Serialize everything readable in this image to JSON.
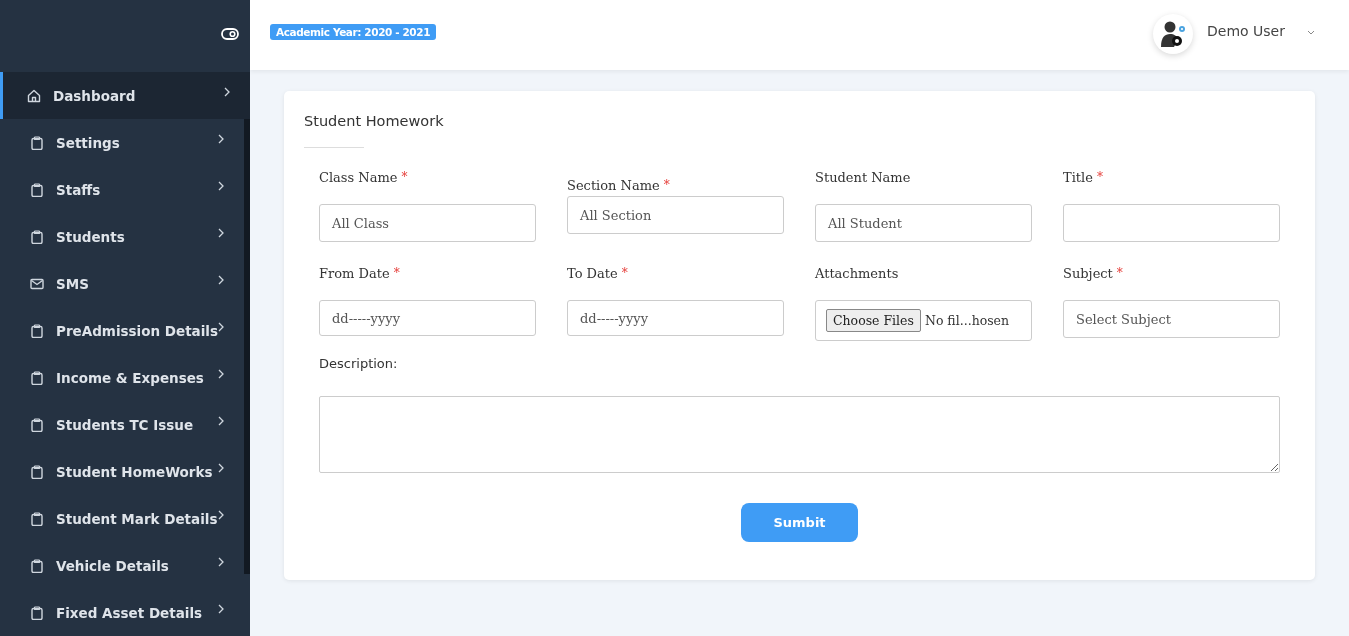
{
  "header": {
    "academic_year_badge": "Academic Year: 2020 - 2021",
    "user_name": "Demo User"
  },
  "sidebar": {
    "items": [
      {
        "label": "Dashboard",
        "selected": true
      },
      {
        "label": "Settings",
        "selected": false
      },
      {
        "label": "Staffs",
        "selected": false
      },
      {
        "label": "Students",
        "selected": false
      },
      {
        "label": "SMS",
        "selected": false
      },
      {
        "label": "PreAdmission Details",
        "selected": false
      },
      {
        "label": "Income & Expenses",
        "selected": false
      },
      {
        "label": "Students TC Issue",
        "selected": false
      },
      {
        "label": "Student HomeWorks",
        "selected": false
      },
      {
        "label": "Student Mark Details",
        "selected": false
      },
      {
        "label": "Vehicle Details",
        "selected": false
      },
      {
        "label": "Fixed Asset Details",
        "selected": false
      }
    ]
  },
  "form": {
    "title": "Student Homework",
    "fields": [
      {
        "label": "Class Name",
        "required_mark": "*",
        "kind": "select",
        "value": "All Class"
      },
      {
        "label": "Section Name",
        "required_mark": "*",
        "kind": "select",
        "value": "All Section"
      },
      {
        "label": "Student Name",
        "kind": "select",
        "value": "All Student"
      },
      {
        "label": "Title",
        "required_mark": "*",
        "kind": "text"
      },
      {
        "label": "From Date",
        "required_mark": "*",
        "kind": "date",
        "value": "dd-----yyyy"
      },
      {
        "label": "To Date",
        "required_mark": "*",
        "kind": "date",
        "value": "dd-----yyyy"
      },
      {
        "label": "Attachments",
        "kind": "file",
        "button": "Choose Files",
        "value": "No fil...hosen"
      },
      {
        "label": "Subject",
        "required_mark": "*",
        "kind": "select",
        "value": "Select Subject"
      }
    ],
    "description_label": "Description:",
    "submit_button": "Sumbit"
  }
}
